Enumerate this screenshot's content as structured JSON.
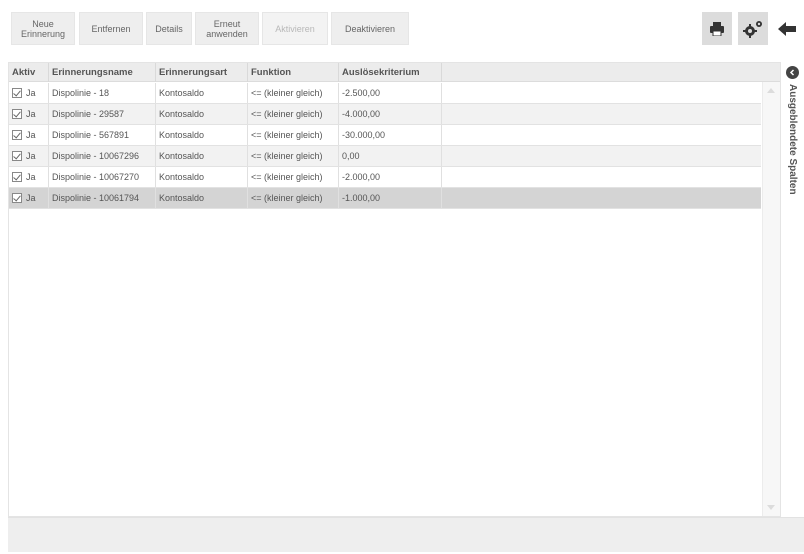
{
  "toolbar": {
    "buttons": [
      {
        "label": "Neue\nErinnerung",
        "enabled": true
      },
      {
        "label": "Entfernen",
        "enabled": true
      },
      {
        "label": "Details",
        "enabled": true
      },
      {
        "label": "Erneut\nanwenden",
        "enabled": true
      },
      {
        "label": "Aktivieren",
        "enabled": false
      },
      {
        "label": "Deaktivieren",
        "enabled": true
      }
    ],
    "icons": [
      "printer-icon",
      "settings-gears-icon",
      "back-arrow-icon"
    ]
  },
  "table": {
    "columns": [
      "Aktiv",
      "Erinnerungsname",
      "Erinnerungsart",
      "Funktion",
      "Auslösekriterium"
    ],
    "rows": [
      {
        "aktiv": "Ja",
        "name": "Dispolinie - 18",
        "art": "Kontosaldo",
        "funktion": "<= (kleiner gleich)",
        "kriterium": "-2.500,00",
        "checked": true
      },
      {
        "aktiv": "Ja",
        "name": "Dispolinie - 29587",
        "art": "Kontosaldo",
        "funktion": "<= (kleiner gleich)",
        "kriterium": "-4.000,00",
        "checked": true
      },
      {
        "aktiv": "Ja",
        "name": "Dispolinie - 567891",
        "art": "Kontosaldo",
        "funktion": "<= (kleiner gleich)",
        "kriterium": "-30.000,00",
        "checked": true
      },
      {
        "aktiv": "Ja",
        "name": "Dispolinie - 10067296",
        "art": "Kontosaldo",
        "funktion": "<= (kleiner gleich)",
        "kriterium": "0,00",
        "checked": true
      },
      {
        "aktiv": "Ja",
        "name": "Dispolinie - 10067270",
        "art": "Kontosaldo",
        "funktion": "<= (kleiner gleich)",
        "kriterium": "-2.000,00",
        "checked": true
      },
      {
        "aktiv": "Ja",
        "name": "Dispolinie - 10061794",
        "art": "Kontosaldo",
        "funktion": "<= (kleiner gleich)",
        "kriterium": "-1.000,00",
        "checked": true
      }
    ],
    "selected_row": 5
  },
  "side_panel": {
    "label": "Ausgeblendete Spalten"
  },
  "colors": {
    "toolbar_button_bg": "#eeeeee",
    "header_bg": "#ececec",
    "alt_row_bg": "#f2f2f2",
    "selected_row_bg": "#d4d4d4"
  }
}
